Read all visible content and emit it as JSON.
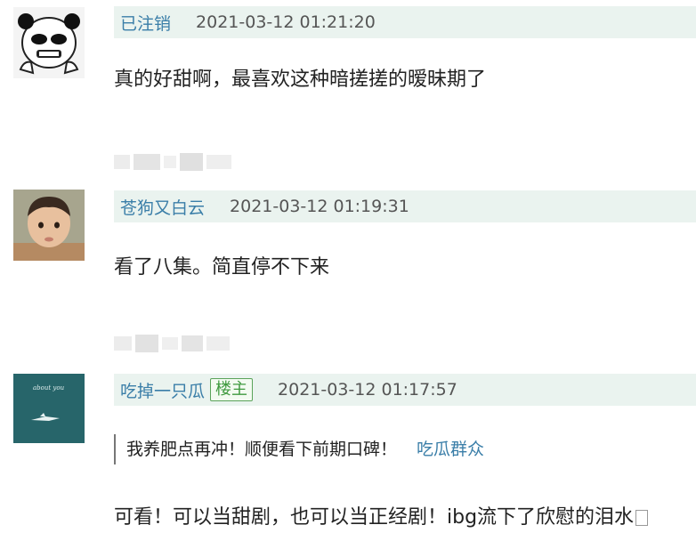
{
  "comments": [
    {
      "username": "已注销",
      "timestamp": "2021-03-12 01:21:20",
      "text": "真的好甜啊，最喜欢这种暗搓搓的暧昧期了",
      "avatar_icon": "panda-meme-avatar"
    },
    {
      "username": "苍狗又白云",
      "timestamp": "2021-03-12 01:19:31",
      "text": "看了八集。简直停不下来",
      "avatar_icon": "toddler-photo-avatar"
    },
    {
      "username": "吃掉一只瓜",
      "badge": "楼主",
      "timestamp": "2021-03-12 01:17:57",
      "quote": {
        "text": "我养肥点再冲！顺便看下前期口碑！",
        "user": "吃瓜群众"
      },
      "text": "可看！可以当甜剧，也可以当正经剧！ibg流下了欣慰的泪水",
      "avatar_icon": "teal-artwork-avatar",
      "avatar_art_text": "about you"
    }
  ],
  "colors": {
    "username": "#3a7ea8",
    "meta_bg": "#eaf3ef",
    "badge_green": "#3f9a3f"
  }
}
